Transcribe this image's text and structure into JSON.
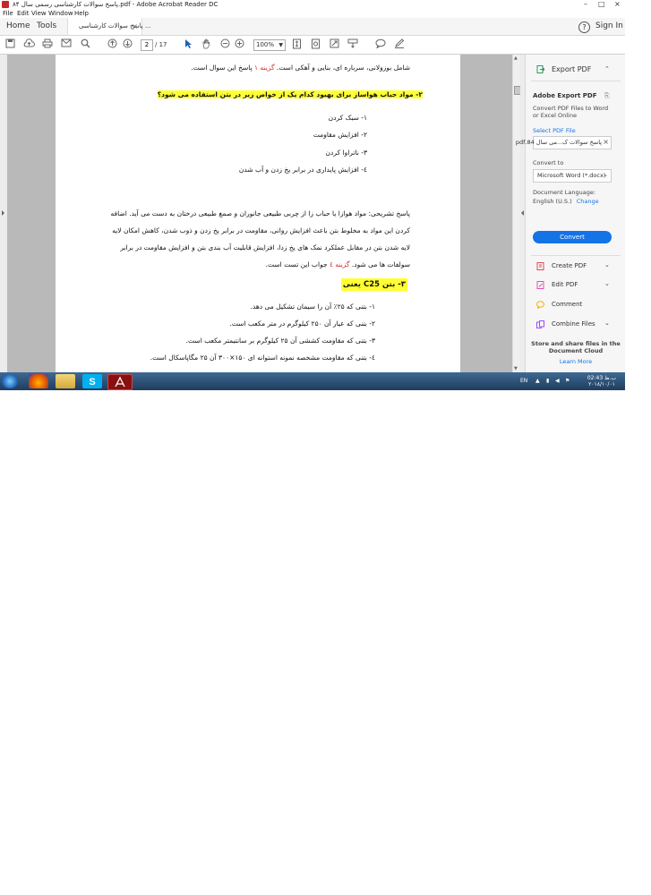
{
  "window": {
    "title": "پاسخ سوالات کارشناسی رسمی سال ۸۴.pdf - Adobe Acrobat Reader DC",
    "controls": [
      "–",
      "□",
      "×"
    ]
  },
  "menu": [
    "File",
    "Edit",
    "View",
    "Window",
    "Help"
  ],
  "nav": {
    "home": "Home",
    "tools": "Tools",
    "doc_tab": "پاسخ سوالات کارشناسی ...",
    "doc_tab_close": "×",
    "help": "?",
    "sign_in": "Sign In"
  },
  "toolbar": {
    "page_current": "2",
    "page_total": "/ 17",
    "zoom": "100%"
  },
  "document": {
    "lines": [
      {
        "text": "شامل بوزولانی، سرباره ای، بنایی و آهکی است. گزینه ۱ پاسخ این سوال است."
      },
      {
        "text": "۲- مواد حباب هواساز برای بهبود کدام یک از خواص زیر در بتن استفاده می شود؟"
      },
      {
        "text": "۱- سبک کردن"
      },
      {
        "text": "۲- افزایش مقاومت"
      },
      {
        "text": "۳- ناتراوا کردن"
      },
      {
        "text": "٤- افزایش پایداری در برابر یخ زدن و آب شدن"
      },
      {
        "text": "پاسخ تشریحی: مواد هوازا یا حباب زا از چربی طبیعی جانوران و صمغ طبیعی درختان به دست می آید. اضافه"
      },
      {
        "text": "کردن این مواد به مخلوط بتن باعث افزایش روانی، مقاومت در برابر یخ زدن و ذوب شدن، کاهش امکان لایه"
      },
      {
        "text": "لایه شدن بتن در مقابل عملکرد نمک های یخ زدا، افزایش قابلیت آب بندی بتن و افزایش مقاومت در برابر"
      },
      {
        "text": "سولفات ها می شود. گزینه ٤ جواب این تست است."
      },
      {
        "text": "۳- بتن C25 یعنی"
      },
      {
        "text": "۱- بتنی که ۲۵٪ آن را سیمان تشکیل می دهد."
      },
      {
        "text": "۲- بتنی که عیار آن ۲۵۰ کیلوگرم در متر مکعب است."
      },
      {
        "text": "۳- بتنی که مقاومت کششی آن ۲۵ کیلوگرم بر سانتیمتر مکعب است."
      },
      {
        "text": "٤- بتنی که مقاومت مشخصه نمونه استوانه ای ۱۵۰×۳۰۰ آن ۲۵ مگاپاسکال است."
      }
    ],
    "answer_ref_1": "گزینه ۱",
    "answer_ref_4": "گزینه ٤"
  },
  "right_pane": {
    "export_title": "Export PDF",
    "section_title": "Adobe Export PDF",
    "section_desc_1": "Convert PDF Files to Word",
    "section_desc_2": "or Excel Online",
    "select_label": "Select PDF File",
    "selected_file": "پاسخ سوالات ک...می سال 84.pdf",
    "convert_to_label": "Convert to",
    "convert_to_value": "Microsoft Word (*.docx)",
    "doc_lang_label": "Document Language:",
    "doc_lang_value": "English (U.S.)",
    "change_link": "Change",
    "convert_button": "Convert",
    "tools": [
      {
        "label": "Create PDF",
        "color": "#e34850"
      },
      {
        "label": "Edit PDF",
        "color": "#e44db5"
      },
      {
        "label": "Comment",
        "color": "#f5b000"
      },
      {
        "label": "Combine Files",
        "color": "#9a4dff"
      }
    ],
    "cloud_text_1": "Store and share files in the",
    "cloud_text_2": "Document Cloud",
    "learn_more": "Learn More"
  },
  "taskbar": {
    "lang": "EN",
    "clock_time": "02:43 ب.ظ",
    "clock_date": "۲۰۱۸/۱۰/۰۱"
  }
}
